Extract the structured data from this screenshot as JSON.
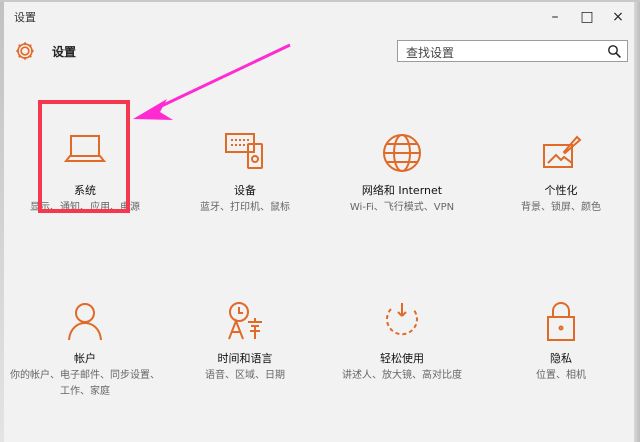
{
  "window": {
    "title": "设置",
    "minimize": "–",
    "maximize": "□",
    "close": "×"
  },
  "header": {
    "title": "设置",
    "icon": "gear-icon"
  },
  "search": {
    "placeholder": "查找设置",
    "icon": "search-icon"
  },
  "tiles": [
    {
      "name": "系统",
      "desc": "显示、通知、应用、电源",
      "icon": "laptop-icon"
    },
    {
      "name": "设备",
      "desc": "蓝牙、打印机、鼠标",
      "icon": "devices-icon"
    },
    {
      "name": "网络和 Internet",
      "desc": "Wi-Fi、飞行模式、VPN",
      "icon": "globe-icon"
    },
    {
      "name": "个性化",
      "desc": "背景、锁屏、颜色",
      "icon": "paint-icon"
    },
    {
      "name": "帐户",
      "desc": "你的帐户、电子邮件、同步设置、工作、家庭",
      "icon": "person-icon"
    },
    {
      "name": "时间和语言",
      "desc": "语音、区域、日期",
      "icon": "time-language-icon"
    },
    {
      "name": "轻松使用",
      "desc": "讲述人、放大镜、高对比度",
      "icon": "ease-access-icon"
    },
    {
      "name": "隐私",
      "desc": "位置、相机",
      "icon": "lock-icon"
    }
  ],
  "colors": {
    "accent": "#e06a27",
    "annotation": "#f6384f",
    "arrow": "#ff2ad2"
  }
}
